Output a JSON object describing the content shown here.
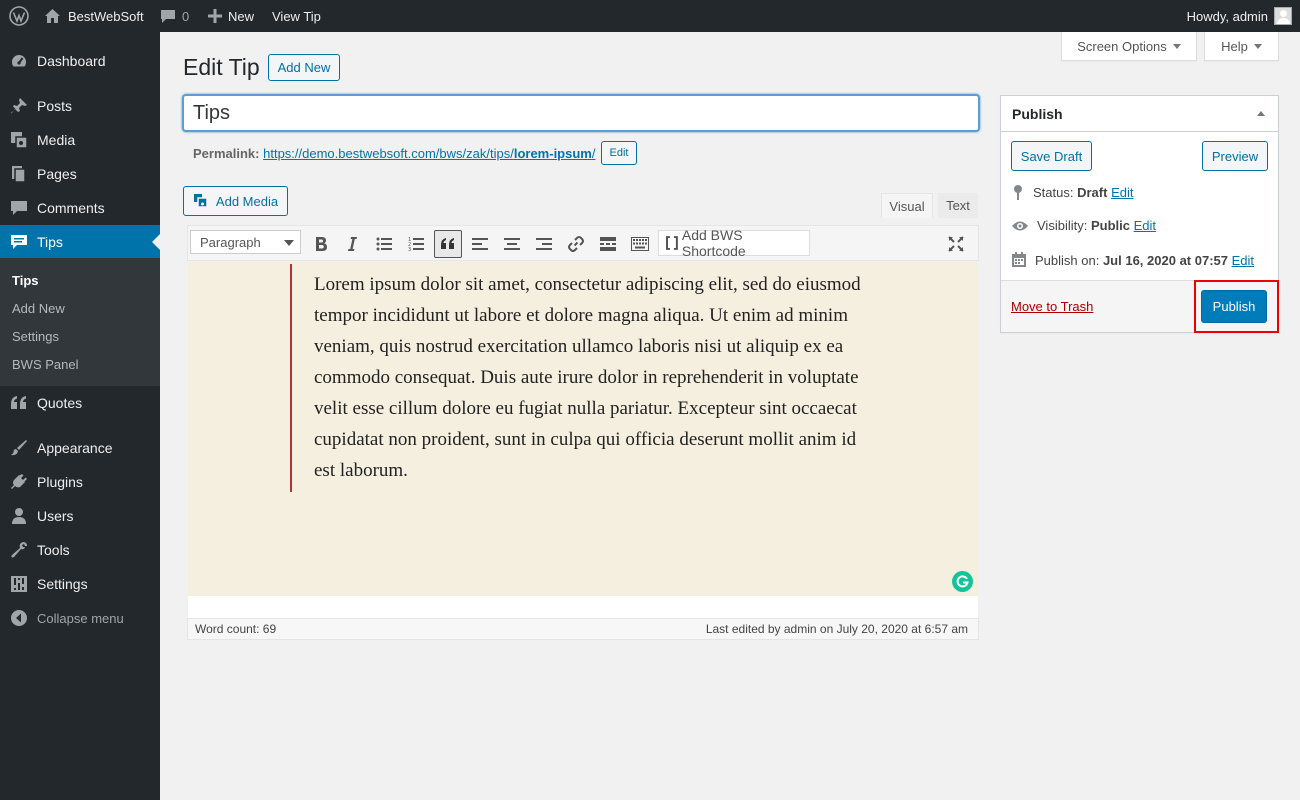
{
  "adminbar": {
    "site_name": "BestWebSoft",
    "comments_count": "0",
    "new_label": "New",
    "view_label": "View Tip",
    "howdy": "Howdy, admin"
  },
  "sidebar": {
    "items": [
      {
        "label": "Dashboard",
        "icon": "dashboard-icon"
      },
      {
        "label": "Posts",
        "icon": "pin-icon"
      },
      {
        "label": "Media",
        "icon": "media-icon"
      },
      {
        "label": "Pages",
        "icon": "pages-icon"
      },
      {
        "label": "Comments",
        "icon": "comment-icon"
      },
      {
        "label": "Tips",
        "icon": "tips-icon"
      },
      {
        "label": "Quotes",
        "icon": "quote-icon"
      },
      {
        "label": "Appearance",
        "icon": "brush-icon"
      },
      {
        "label": "Plugins",
        "icon": "plug-icon"
      },
      {
        "label": "Users",
        "icon": "user-icon"
      },
      {
        "label": "Tools",
        "icon": "wrench-icon"
      },
      {
        "label": "Settings",
        "icon": "settings-icon"
      }
    ],
    "submenu": [
      "Tips",
      "Add New",
      "Settings",
      "BWS Panel"
    ],
    "collapse_label": "Collapse menu"
  },
  "header": {
    "screen_options": "Screen Options",
    "help": "Help",
    "title": "Edit Tip",
    "add_new": "Add New"
  },
  "editor": {
    "post_title": "Tips",
    "permalink_label": "Permalink:",
    "permalink_base": "https://demo.bestwebsoft.com/bws/zak/tips/",
    "permalink_slug": "lorem-ipsum",
    "permalink_trailing": "/",
    "permalink_edit": "Edit",
    "add_media": "Add Media",
    "tab_visual": "Visual",
    "tab_text": "Text",
    "format": "Paragraph",
    "bws_shortcode": "Add BWS Shortcode",
    "content": "Lorem ipsum dolor sit amet, consectetur adipiscing elit, sed do eiusmod tempor incididunt ut labore et dolore magna aliqua. Ut enim ad minim veniam, quis nostrud exercitation ullamco laboris nisi ut aliquip ex ea commodo consequat. Duis aute irure dolor in reprehenderit in voluptate velit esse cillum dolore eu fugiat nulla pariatur. Excepteur sint occaecat cupidatat non proident, sunt in culpa qui officia deserunt mollit anim id est laborum.",
    "word_count": "Word count: 69",
    "last_edited": "Last edited by admin on July 20, 2020 at 6:57 am"
  },
  "publish": {
    "title": "Publish",
    "save_draft": "Save Draft",
    "preview": "Preview",
    "status_label": "Status:",
    "status_value": "Draft",
    "visibility_label": "Visibility:",
    "visibility_value": "Public",
    "publish_on_label": "Publish on:",
    "publish_on_value": "Jul 16, 2020 at 07:57",
    "edit": "Edit",
    "move_to_trash": "Move to Trash",
    "publish_button": "Publish"
  }
}
